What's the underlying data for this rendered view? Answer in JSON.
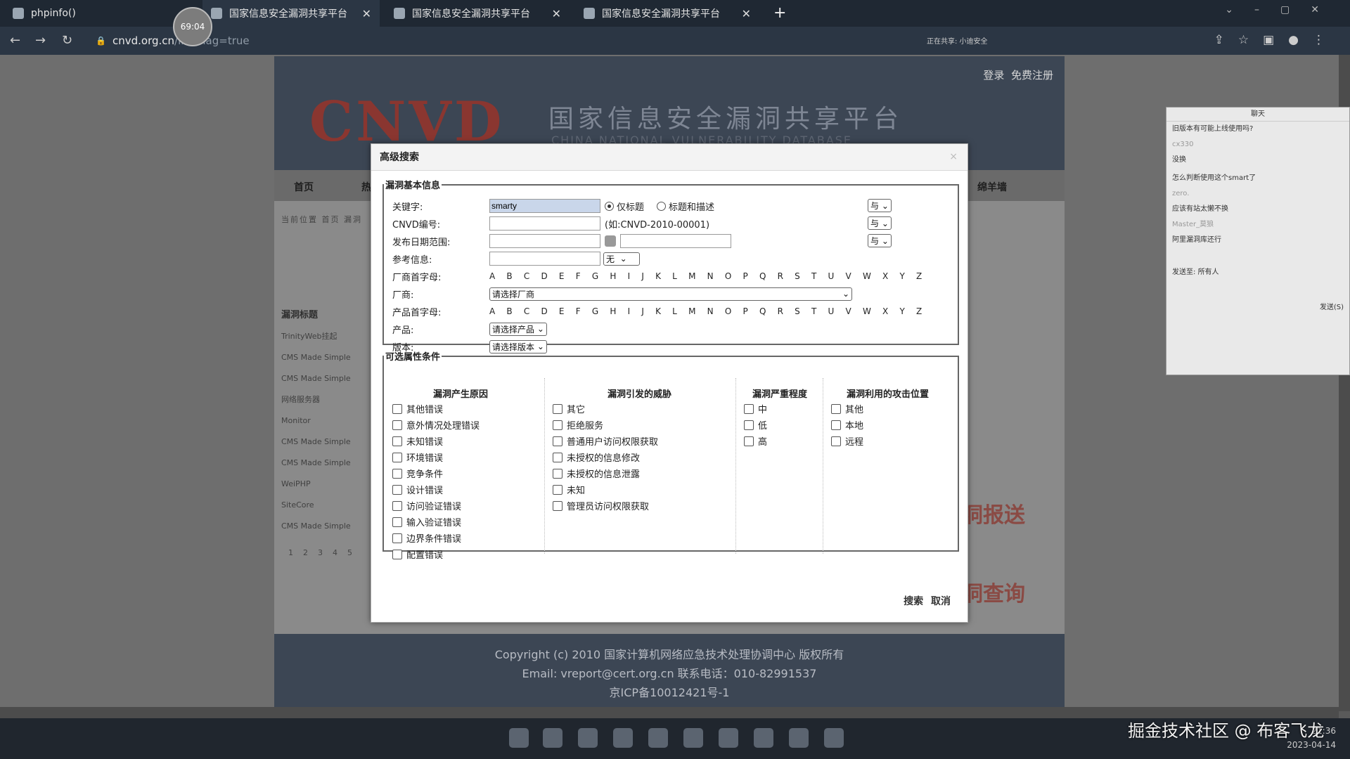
{
  "browser": {
    "tabs": [
      {
        "label": "phpinfo()"
      },
      {
        "label": "国家信息安全漏洞共享平台"
      },
      {
        "label": "国家信息安全漏洞共享平台"
      },
      {
        "label": "国家信息安全漏洞共享平台"
      }
    ],
    "timer": "69:04",
    "url_host": "cnvd.org.cn",
    "url_path": "/list?flag=true",
    "sharing_text": "正在共享: 小迪安全"
  },
  "site": {
    "logo": "CNVD",
    "title_cn": "国家信息安全漏洞共享平台",
    "title_en": "CHINA NATIONAL VULNERABILITY DATABASE",
    "login": "登录",
    "register": "免费注册",
    "nav": {
      "home": "首页",
      "hot": "热",
      "last": "绵羊墙"
    },
    "crumb": "当前位置  首页  漏洞",
    "list_header": "漏洞标题",
    "list_items": [
      "TrinityWeb挂起",
      "CMS Made Simple",
      "CMS Made Simple",
      "网络服务器",
      "Monitor",
      "CMS Made Simple",
      "CMS Made Simple",
      "WeiPHP",
      "SiteCore",
      "CMS Made Simple"
    ],
    "pages": [
      "1",
      "2",
      "3",
      "4",
      "5"
    ],
    "right_text_1": "洞报送",
    "right_text_2": "洞查询",
    "footer_line1": "Copyright (c) 2010 国家计算机网络应急技术处理协调中心 版权所有",
    "footer_line2": "Email:  vreport@cert.org.cn 联系电话：010-82991537",
    "footer_line3": "京ICP备10012421号-1"
  },
  "modal": {
    "title": "高级搜索",
    "close": "×",
    "basic_legend": "漏洞基本信息",
    "keyword_label": "关键字:",
    "keyword_value": "smarty",
    "radio_title_only": "仅标题",
    "radio_title_desc": "标题和描述",
    "cnvd_label": "CNVD编号:",
    "cnvd_hint": "(如:CNVD-2010-00001)",
    "date_label": "发布日期范围:",
    "ref_label": "参考信息:",
    "ref_value": "无",
    "vendor_letter_label": "厂商首字母:",
    "letters": "A B C D E F G H I J K L M N O P Q R S T U V W X Y Z",
    "vendor_label": "厂商:",
    "vendor_value": "请选择厂商",
    "product_letter_label": "产品首字母:",
    "product_label": "产品:",
    "product_value": "请选择产品",
    "version_label": "版本:",
    "version_value": "请选择版本",
    "logic_op": "与",
    "optional_legend": "可选属性条件",
    "col_cause": "漏洞产生原因",
    "col_threat": "漏洞引发的威胁",
    "col_severity": "漏洞严重程度",
    "col_position": "漏洞利用的攻击位置",
    "causes": [
      "其他错误",
      "意外情况处理错误",
      "未知错误",
      "环境错误",
      "竞争条件",
      "设计错误",
      "访问验证错误",
      "输入验证错误",
      "边界条件错误",
      "配置错误"
    ],
    "threats": [
      "其它",
      "拒绝服务",
      "普通用户访问权限获取",
      "未授权的信息修改",
      "未授权的信息泄露",
      "未知",
      "管理员访问权限获取"
    ],
    "severities": [
      "中",
      "低",
      "高"
    ],
    "positions": [
      "其他",
      "本地",
      "远程"
    ],
    "search_btn": "搜索",
    "cancel_btn": "取消"
  },
  "chat": {
    "title": "聊天",
    "messages": [
      "旧版本有可能上线使用吗?",
      "cx330",
      "没换",
      "",
      "怎么判断使用这个smart了",
      "zero.",
      "应该有站太懒不换",
      "Master_莫狼",
      "阿里漏洞库还行"
    ],
    "send_to_label": "发送至:",
    "send_to_value": "所有人",
    "send_btn": "发送(S)"
  },
  "taskbar": {
    "watermark": "掘金技术社区 @ 布客飞龙",
    "time": "21:36",
    "date": "2023-04-14"
  }
}
